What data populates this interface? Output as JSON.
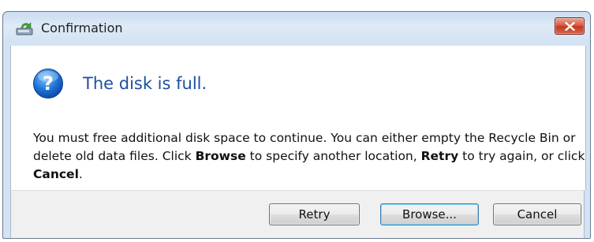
{
  "window": {
    "title": "Confirmation",
    "title_icon": "recycle-drive-icon",
    "close_icon": "close-icon"
  },
  "main": {
    "icon": "question-icon",
    "instruction": "The disk is full.",
    "message": {
      "part1": "You must free additional disk space to continue. You can either empty the Recycle Bin or delete old data files. Click ",
      "bold1": "Browse",
      "part2": " to specify another location, ",
      "bold2": "Retry",
      "part3": " to try again, or click ",
      "bold3": "Cancel",
      "part4": "."
    }
  },
  "buttons": {
    "retry": "Retry",
    "browse": "Browse...",
    "cancel": "Cancel"
  },
  "colors": {
    "instruction_text": "#1f4fa0",
    "close_button": "#c13a20",
    "footer_background": "#f0f0f0"
  }
}
